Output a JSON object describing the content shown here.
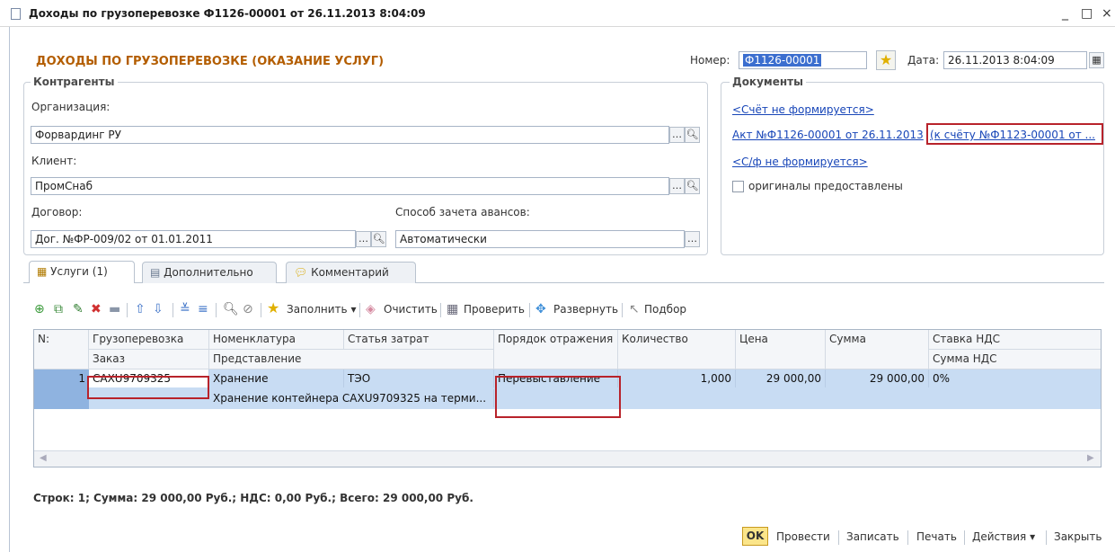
{
  "window": {
    "title": "Доходы по грузоперевозке Ф1126-00001 от 26.11.2013 8:04:09",
    "minimize": "_",
    "maximize": "□",
    "close": "×"
  },
  "form": {
    "heading": "ДОХОДЫ ПО ГРУЗОПЕРЕВОЗКЕ (ОКАЗАНИЕ УСЛУГ)",
    "number_label": "Номер:",
    "number_value": "Ф1126-00001",
    "date_label": "Дата:",
    "date_value": "26.11.2013  8:04:09"
  },
  "counterparties": {
    "title": "Контрагенты",
    "organization_label": "Организация:",
    "organization_value": "Форвардинг РУ",
    "client_label": "Клиент:",
    "client_value": "ПромСнаб",
    "contract_label": "Договор:",
    "contract_value": "Дог. №ФР-009/02 от 01.01.2011",
    "advance_label": "Способ зачета авансов:",
    "advance_value": "Автоматически"
  },
  "documents": {
    "title": "Документы",
    "invoice_link": "<Счёт не формируется>",
    "act_link": "Акт №Ф1126-00001 от 26.11.2013",
    "act_ref_link": "(к счёту №Ф1123-00001 от ...",
    "sf_link": "<С/ф не формируется>",
    "originals_label": "оригиналы предоставлены"
  },
  "tabs": [
    {
      "label": "Услуги (1)"
    },
    {
      "label": "Дополнительно"
    },
    {
      "label": "Комментарий"
    }
  ],
  "toolbar": {
    "fill": "Заполнить",
    "clear": "Очистить",
    "check": "Проверить",
    "expand": "Развернуть",
    "select": "Подбор"
  },
  "grid": {
    "headers_top": [
      "N:",
      "Грузоперевозка",
      "Номенклатура",
      "Статья затрат",
      "Порядок отражения",
      "Количество",
      "Цена",
      "Сумма",
      "Ставка НДС"
    ],
    "headers_bottom": [
      "Заказ",
      "Представление",
      "Сумма НДС"
    ],
    "rows": [
      {
        "n": "1",
        "cargo": "CAXU9709325",
        "nomenclature": "Хранение",
        "expense": "ТЭО",
        "order": "Перевыставление",
        "qty": "1,000",
        "price": "29 000,00",
        "sum": "29 000,00",
        "vat_rate": "0%",
        "representation": "Хранение контейнера CAXU9709325 на терми..."
      }
    ]
  },
  "summary": "Строк: 1;  Сумма: 29 000,00 Руб.;  НДС: 0,00 Руб.;  Всего: 29 000,00 Руб.",
  "buttons": {
    "ok": "OK",
    "post": "Провести",
    "save": "Записать",
    "print": "Печать",
    "actions": "Действия",
    "close": "Закрыть"
  },
  "colors": {
    "accent_orange": "#b35d00",
    "highlight_red": "#b8232b",
    "row_selected": "#c8dcf3",
    "link_blue": "#1846b8"
  }
}
